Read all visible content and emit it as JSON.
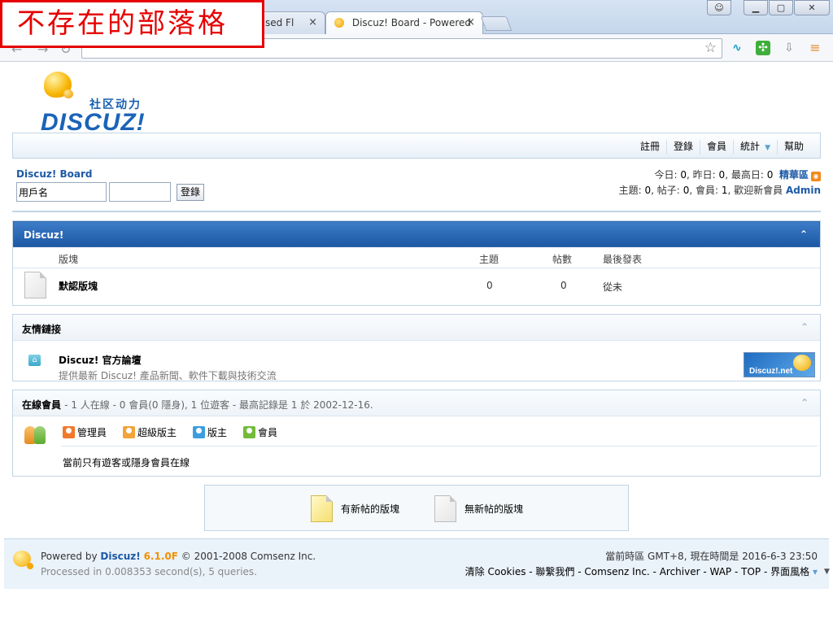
{
  "overlay": {
    "label": "不存在的部落格"
  },
  "browser": {
    "tabs": [
      {
        "title": "based Fl"
      },
      {
        "title": "Discuz! Board - Powered"
      }
    ],
    "close_glyph": "×"
  },
  "site": {
    "logo_cn": "社区动力",
    "logo_en": "DISCUZ!",
    "menu": [
      {
        "label": "註冊"
      },
      {
        "label": "登錄"
      },
      {
        "label": "會員"
      },
      {
        "label": "統計"
      },
      {
        "label": "幫助"
      }
    ]
  },
  "login": {
    "board_name": "Discuz! Board",
    "username_value": "用戶名",
    "button": "登錄"
  },
  "stats": {
    "line1_prefix": "今日:",
    "today": "0",
    "yesterday_label": ", 昨日:",
    "yesterday": "0",
    "max_label": ", 最高日:",
    "max": "0",
    "digest_link": "精華區",
    "line2_topics_label": "主題:",
    "topics": "0",
    "posts_label": ", 帖子:",
    "posts": "0",
    "members_label": ", 會員:",
    "members": "1",
    "welcome_label": ", 歡迎新會員",
    "newest_member": "Admin"
  },
  "forum_table": {
    "category": "Discuz!",
    "collapse_glyph": "⌃",
    "columns": {
      "forum": "版塊",
      "topics": "主題",
      "posts": "帖數",
      "last_post": "最後發表"
    },
    "rows": [
      {
        "name": "默認版塊",
        "topics": "0",
        "posts": "0",
        "last_post": "從未"
      }
    ]
  },
  "friend_links": {
    "title": "友情鏈接",
    "items": [
      {
        "name": "Discuz! 官方論壇",
        "description": "提供最新 Discuz! 產品新聞、軟件下載與技術交流",
        "badge": "Discuz!.net"
      }
    ]
  },
  "online": {
    "title": "在線會員",
    "summary": "- 1 人在線 - 0 會員(0 隱身), 1 位遊客 - 最高記錄是 1 於 2002-12-16.",
    "legend": [
      {
        "label": "管理員",
        "color": "#f07a2a"
      },
      {
        "label": "超級版主",
        "color": "#f2a33a"
      },
      {
        "label": "版主",
        "color": "#3c9ee0"
      },
      {
        "label": "會員",
        "color": "#74bb3a"
      }
    ],
    "message": "當前只有遊客或隱身會員在線"
  },
  "forum_legend": {
    "new_posts": "有新帖的版塊",
    "no_new_posts": "無新帖的版塊"
  },
  "footer": {
    "powered_prefix": "Powered by",
    "brand": "Discuz!",
    "version": "6.1.0F",
    "copyright": "© 2001-2008 Comsenz Inc.",
    "processed": "Processed in 0.008353 second(s), 5 queries.",
    "timezone": "當前時區 GMT+8, 現在時間是 2016-6-3 23:50",
    "links": [
      "清除 Cookies",
      "聯繫我們",
      "Comsenz Inc.",
      "Archiver",
      "WAP",
      "TOP",
      "界面風格"
    ],
    "style_caret": "▾"
  }
}
